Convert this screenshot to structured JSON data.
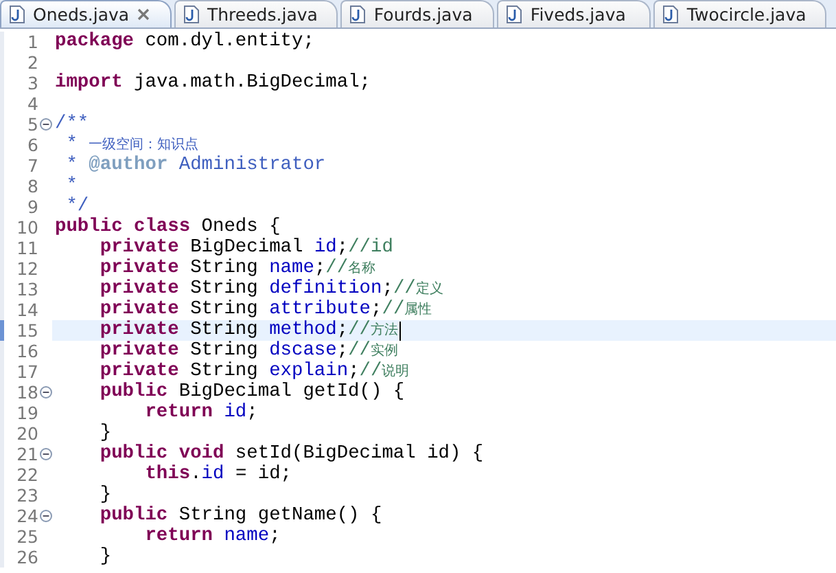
{
  "tabs": [
    {
      "label": "Oneds.java",
      "selected": true,
      "closable": true
    },
    {
      "label": "Threeds.java",
      "selected": false,
      "closable": false
    },
    {
      "label": "Fourds.java",
      "selected": false,
      "closable": false
    },
    {
      "label": "Fiveds.java",
      "selected": false,
      "closable": false
    },
    {
      "label": "Twocircle.java",
      "selected": false,
      "closable": false
    }
  ],
  "lines": [
    {
      "number": "1",
      "fold": false,
      "current": false,
      "tokens": [
        {
          "kind": "keyword",
          "text": "package"
        },
        {
          "kind": "plain",
          "text": " com.dyl.entity;"
        }
      ]
    },
    {
      "number": "2",
      "fold": false,
      "current": false
    },
    {
      "number": "3",
      "fold": false,
      "current": false,
      "tokens": [
        {
          "kind": "keyword",
          "text": "import"
        },
        {
          "kind": "plain",
          "text": " java.math.BigDecimal;"
        }
      ]
    },
    {
      "number": "4",
      "fold": false,
      "current": false
    },
    {
      "number": "5",
      "fold": true,
      "current": false,
      "tokens": [
        {
          "kind": "javadoc",
          "text": "/**"
        }
      ]
    },
    {
      "number": "6",
      "fold": false,
      "current": false,
      "tokens": [
        {
          "kind": "javadoc",
          "text": " * "
        },
        {
          "kind": "javadoc-cjk",
          "text": "一级空间：知识点"
        }
      ]
    },
    {
      "number": "7",
      "fold": false,
      "current": false,
      "tokens": [
        {
          "kind": "javadoc",
          "text": " * "
        },
        {
          "kind": "doctag",
          "text": "@author"
        },
        {
          "kind": "javadoc",
          "text": " Administrator"
        }
      ]
    },
    {
      "number": "8",
      "fold": false,
      "current": false,
      "tokens": [
        {
          "kind": "javadoc",
          "text": " *"
        }
      ]
    },
    {
      "number": "9",
      "fold": false,
      "current": false,
      "tokens": [
        {
          "kind": "javadoc",
          "text": " */"
        }
      ]
    },
    {
      "number": "10",
      "fold": false,
      "current": false,
      "tokens": [
        {
          "kind": "keyword",
          "text": "public class"
        },
        {
          "kind": "plain",
          "text": " Oneds {"
        }
      ]
    },
    {
      "number": "11",
      "fold": false,
      "current": false,
      "tokens": [
        {
          "kind": "keyword",
          "text": "    private"
        },
        {
          "kind": "plain",
          "text": " BigDecimal "
        },
        {
          "kind": "field",
          "text": "id"
        },
        {
          "kind": "plain",
          "text": ";"
        },
        {
          "kind": "comment",
          "text": "//id"
        }
      ]
    },
    {
      "number": "12",
      "fold": false,
      "current": false,
      "tokens": [
        {
          "kind": "keyword",
          "text": "    private"
        },
        {
          "kind": "plain",
          "text": " String "
        },
        {
          "kind": "field",
          "text": "name"
        },
        {
          "kind": "plain",
          "text": ";"
        },
        {
          "kind": "comment",
          "text": "//"
        },
        {
          "kind": "comment-cjk",
          "text": "名称"
        }
      ]
    },
    {
      "number": "13",
      "fold": false,
      "current": false,
      "tokens": [
        {
          "kind": "keyword",
          "text": "    private"
        },
        {
          "kind": "plain",
          "text": " String "
        },
        {
          "kind": "field",
          "text": "definition"
        },
        {
          "kind": "plain",
          "text": ";"
        },
        {
          "kind": "comment",
          "text": "//"
        },
        {
          "kind": "comment-cjk",
          "text": "定义"
        }
      ]
    },
    {
      "number": "14",
      "fold": false,
      "current": false,
      "tokens": [
        {
          "kind": "keyword",
          "text": "    private"
        },
        {
          "kind": "plain",
          "text": " String "
        },
        {
          "kind": "field",
          "text": "attribute"
        },
        {
          "kind": "plain",
          "text": ";"
        },
        {
          "kind": "comment",
          "text": "//"
        },
        {
          "kind": "comment-cjk",
          "text": "属性"
        }
      ]
    },
    {
      "number": "15",
      "fold": false,
      "current": true,
      "tokens": [
        {
          "kind": "keyword",
          "text": "    private"
        },
        {
          "kind": "plain",
          "text": " String "
        },
        {
          "kind": "field",
          "text": "method"
        },
        {
          "kind": "plain",
          "text": ";"
        },
        {
          "kind": "comment",
          "text": "//"
        },
        {
          "kind": "comment-cjk",
          "text": "方法"
        }
      ]
    },
    {
      "number": "16",
      "fold": false,
      "current": false,
      "tokens": [
        {
          "kind": "keyword",
          "text": "    private"
        },
        {
          "kind": "plain",
          "text": " String "
        },
        {
          "kind": "field",
          "text": "dscase"
        },
        {
          "kind": "plain",
          "text": ";"
        },
        {
          "kind": "comment",
          "text": "//"
        },
        {
          "kind": "comment-cjk",
          "text": "实例"
        }
      ]
    },
    {
      "number": "17",
      "fold": false,
      "current": false,
      "tokens": [
        {
          "kind": "keyword",
          "text": "    private"
        },
        {
          "kind": "plain",
          "text": " String "
        },
        {
          "kind": "field",
          "text": "explain"
        },
        {
          "kind": "plain",
          "text": ";"
        },
        {
          "kind": "comment",
          "text": "//"
        },
        {
          "kind": "comment-cjk",
          "text": "说明"
        }
      ]
    },
    {
      "number": "18",
      "fold": true,
      "current": false,
      "tokens": [
        {
          "kind": "keyword",
          "text": "    public"
        },
        {
          "kind": "plain",
          "text": " BigDecimal getId() {"
        }
      ]
    },
    {
      "number": "19",
      "fold": false,
      "current": false,
      "tokens": [
        {
          "kind": "keyword",
          "text": "        return "
        },
        {
          "kind": "field",
          "text": "id"
        },
        {
          "kind": "plain",
          "text": ";"
        }
      ]
    },
    {
      "number": "20",
      "fold": false,
      "current": false,
      "tokens": [
        {
          "kind": "plain",
          "text": "    }"
        }
      ]
    },
    {
      "number": "21",
      "fold": true,
      "current": false,
      "tokens": [
        {
          "kind": "keyword",
          "text": "    public void"
        },
        {
          "kind": "plain",
          "text": " setId(BigDecimal id) {"
        }
      ]
    },
    {
      "number": "22",
      "fold": false,
      "current": false,
      "tokens": [
        {
          "kind": "keyword",
          "text": "        this"
        },
        {
          "kind": "plain",
          "text": "."
        },
        {
          "kind": "field",
          "text": "id"
        },
        {
          "kind": "plain",
          "text": " = id;"
        }
      ]
    },
    {
      "number": "23",
      "fold": false,
      "current": false,
      "tokens": [
        {
          "kind": "plain",
          "text": "    }"
        }
      ]
    },
    {
      "number": "24",
      "fold": true,
      "current": false,
      "tokens": [
        {
          "kind": "keyword",
          "text": "    public"
        },
        {
          "kind": "plain",
          "text": " String getName() {"
        }
      ]
    },
    {
      "number": "25",
      "fold": false,
      "current": false,
      "tokens": [
        {
          "kind": "keyword",
          "text": "        return "
        },
        {
          "kind": "field",
          "text": "name"
        },
        {
          "kind": "plain",
          "text": ";"
        }
      ]
    },
    {
      "number": "26",
      "fold": false,
      "current": false,
      "tokens": [
        {
          "kind": "plain",
          "text": "    }"
        }
      ]
    }
  ]
}
